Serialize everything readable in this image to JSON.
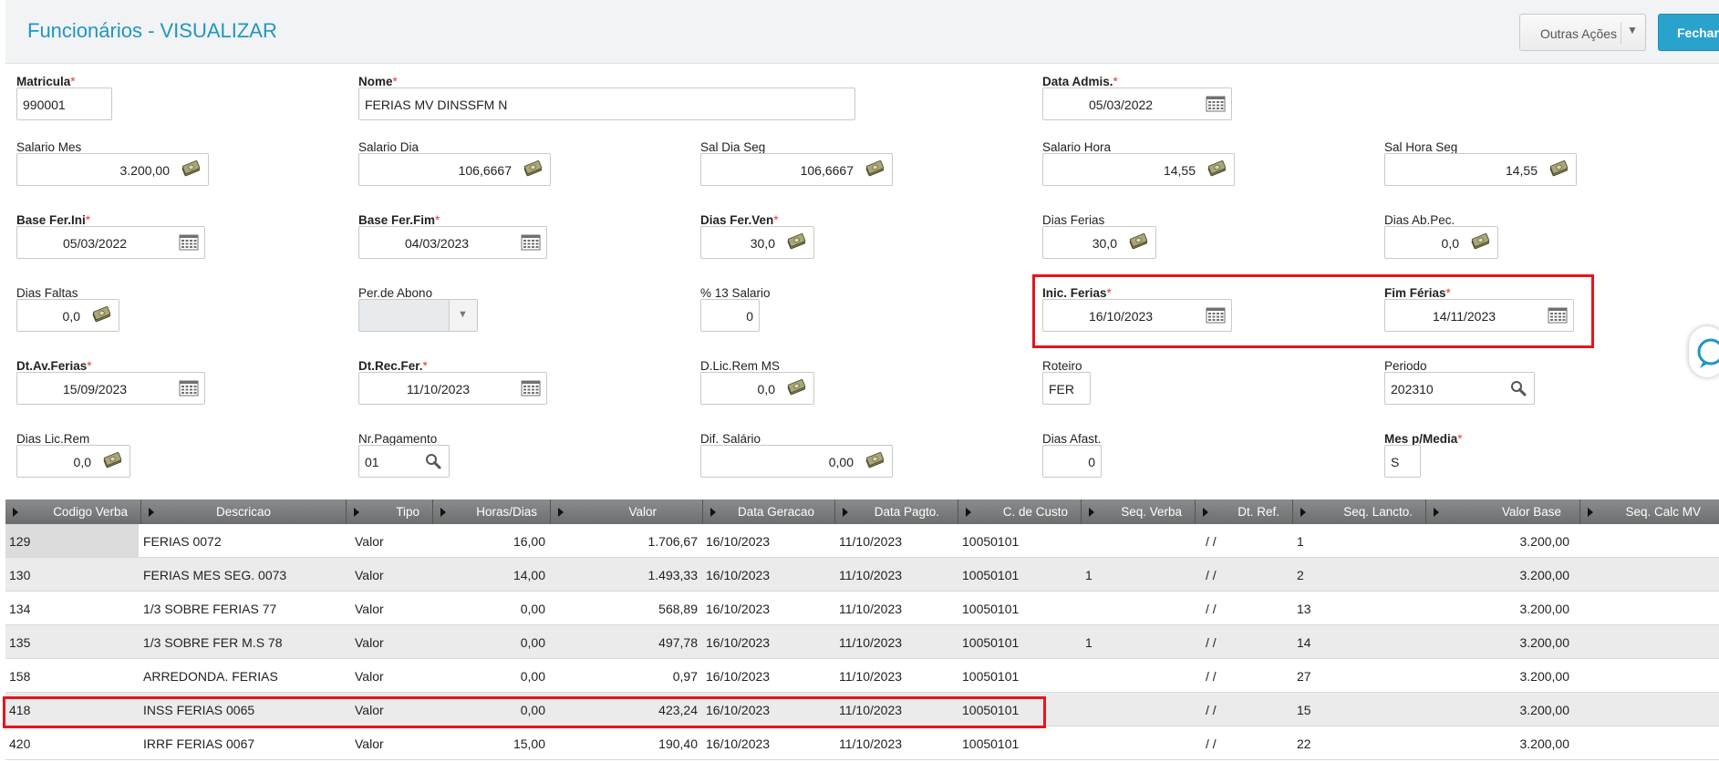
{
  "header": {
    "title": "Funcionários - VISUALIZAR",
    "actions_label": "Outras Ações",
    "close_label": "Fechar"
  },
  "form": {
    "matricula": {
      "label": "Matricula",
      "value": "990001"
    },
    "nome": {
      "label": "Nome",
      "value": "FERIAS MV DINSSFM N"
    },
    "data_admis": {
      "label": "Data Admis.",
      "value": "05/03/2022"
    },
    "salario_mes": {
      "label": "Salario Mes",
      "value": "3.200,00"
    },
    "salario_dia": {
      "label": "Salario Dia",
      "value": "106,6667"
    },
    "sal_dia_seg": {
      "label": "Sal Dia Seg",
      "value": "106,6667"
    },
    "salario_hora": {
      "label": "Salario Hora",
      "value": "14,55"
    },
    "sal_hora_seg": {
      "label": "Sal Hora Seg",
      "value": "14,55"
    },
    "base_fer_ini": {
      "label": "Base Fer.Ini",
      "value": "05/03/2022"
    },
    "base_fer_fim": {
      "label": "Base Fer.Fim",
      "value": "04/03/2023"
    },
    "dias_fer_ven": {
      "label": "Dias Fer.Ven",
      "value": "30,0"
    },
    "dias_ferias": {
      "label": "Dias Ferias",
      "value": "30,0"
    },
    "dias_ab_pec": {
      "label": "Dias Ab.Pec.",
      "value": "0,0"
    },
    "dias_faltas": {
      "label": "Dias Faltas",
      "value": "0,0"
    },
    "per_abono": {
      "label": "Per.de Abono",
      "value": ""
    },
    "pct_13_salario": {
      "label": "% 13 Salario",
      "value": "0"
    },
    "inic_ferias": {
      "label": "Inic. Ferias",
      "value": "16/10/2023"
    },
    "fim_ferias": {
      "label": "Fim Férias",
      "value": "14/11/2023"
    },
    "dt_av_ferias": {
      "label": "Dt.Av.Ferias",
      "value": "15/09/2023"
    },
    "dt_rec_fer": {
      "label": "Dt.Rec.Fer.",
      "value": "11/10/2023"
    },
    "d_lic_rem_ms": {
      "label": "D.Lic.Rem MS",
      "value": "0,0"
    },
    "roteiro": {
      "label": "Roteiro",
      "value": "FER"
    },
    "periodo": {
      "label": "Periodo",
      "value": "202310"
    },
    "dias_lic_rem": {
      "label": "Dias Lic.Rem",
      "value": "0,0"
    },
    "nr_pagamento": {
      "label": "Nr.Pagamento",
      "value": "01"
    },
    "dif_salario": {
      "label": "Dif. Salário",
      "value": "0,00"
    },
    "dias_afast": {
      "label": "Dias Afast.",
      "value": "0"
    },
    "mes_p_media": {
      "label": "Mes p/Media",
      "value": "S"
    }
  },
  "grid": {
    "columns": [
      "Codigo Verba",
      "Descricao",
      "Tipo",
      "Horas/Dias",
      "Valor",
      "Data Geracao",
      "Data Pagto.",
      "C. de Custo",
      "Seq. Verba",
      "Dt. Ref.",
      "Seq. Lancto.",
      "Valor Base",
      "Seq. Calc MV"
    ],
    "rows": [
      {
        "codigo": "129",
        "descricao": "FERIAS 0072",
        "tipo": "Valor",
        "horas": "16,00",
        "valor": "1.706,67",
        "geracao": "16/10/2023",
        "pagto": "11/10/2023",
        "custo": "10050101",
        "seq_verba": "",
        "dt_ref": "/ /",
        "seq_lancto": "1",
        "valor_base": "3.200,00"
      },
      {
        "codigo": "130",
        "descricao": "FERIAS MES SEG. 0073",
        "tipo": "Valor",
        "horas": "14,00",
        "valor": "1.493,33",
        "geracao": "16/10/2023",
        "pagto": "11/10/2023",
        "custo": "10050101",
        "seq_verba": "1",
        "dt_ref": "/ /",
        "seq_lancto": "2",
        "valor_base": "3.200,00"
      },
      {
        "codigo": "134",
        "descricao": "1/3 SOBRE FERIAS 77",
        "tipo": "Valor",
        "horas": "0,00",
        "valor": "568,89",
        "geracao": "16/10/2023",
        "pagto": "11/10/2023",
        "custo": "10050101",
        "seq_verba": "",
        "dt_ref": "/ /",
        "seq_lancto": "13",
        "valor_base": "3.200,00"
      },
      {
        "codigo": "135",
        "descricao": "1/3 SOBRE FER M.S 78",
        "tipo": "Valor",
        "horas": "0,00",
        "valor": "497,78",
        "geracao": "16/10/2023",
        "pagto": "11/10/2023",
        "custo": "10050101",
        "seq_verba": "1",
        "dt_ref": "/ /",
        "seq_lancto": "14",
        "valor_base": "3.200,00"
      },
      {
        "codigo": "158",
        "descricao": "ARREDONDA. FERIAS",
        "tipo": "Valor",
        "horas": "0,00",
        "valor": "0,97",
        "geracao": "16/10/2023",
        "pagto": "11/10/2023",
        "custo": "10050101",
        "seq_verba": "",
        "dt_ref": "/ /",
        "seq_lancto": "27",
        "valor_base": "3.200,00"
      },
      {
        "codigo": "418",
        "descricao": "INSS FERIAS 0065",
        "tipo": "Valor",
        "horas": "0,00",
        "valor": "423,24",
        "geracao": "16/10/2023",
        "pagto": "11/10/2023",
        "custo": "10050101",
        "seq_verba": "",
        "dt_ref": "/ /",
        "seq_lancto": "15",
        "valor_base": "3.200,00"
      },
      {
        "codigo": "420",
        "descricao": "IRRF FERIAS 0067",
        "tipo": "Valor",
        "horas": "15,00",
        "valor": "190,40",
        "geracao": "16/10/2023",
        "pagto": "11/10/2023",
        "custo": "10050101",
        "seq_verba": "",
        "dt_ref": "/ /",
        "seq_lancto": "22",
        "valor_base": "3.200,00"
      }
    ]
  },
  "icons": {
    "money": "money-stack-icon",
    "calendar": "calendar-icon",
    "search": "search-icon",
    "dropdown": "chevron-down-icon",
    "sort": "sort-arrow-icon",
    "chat": "chat-bubble-icon"
  },
  "colors": {
    "title": "#2196c3",
    "primary_button": "#2aa3cc",
    "required": "#e53935",
    "highlight": "#e8141c"
  }
}
